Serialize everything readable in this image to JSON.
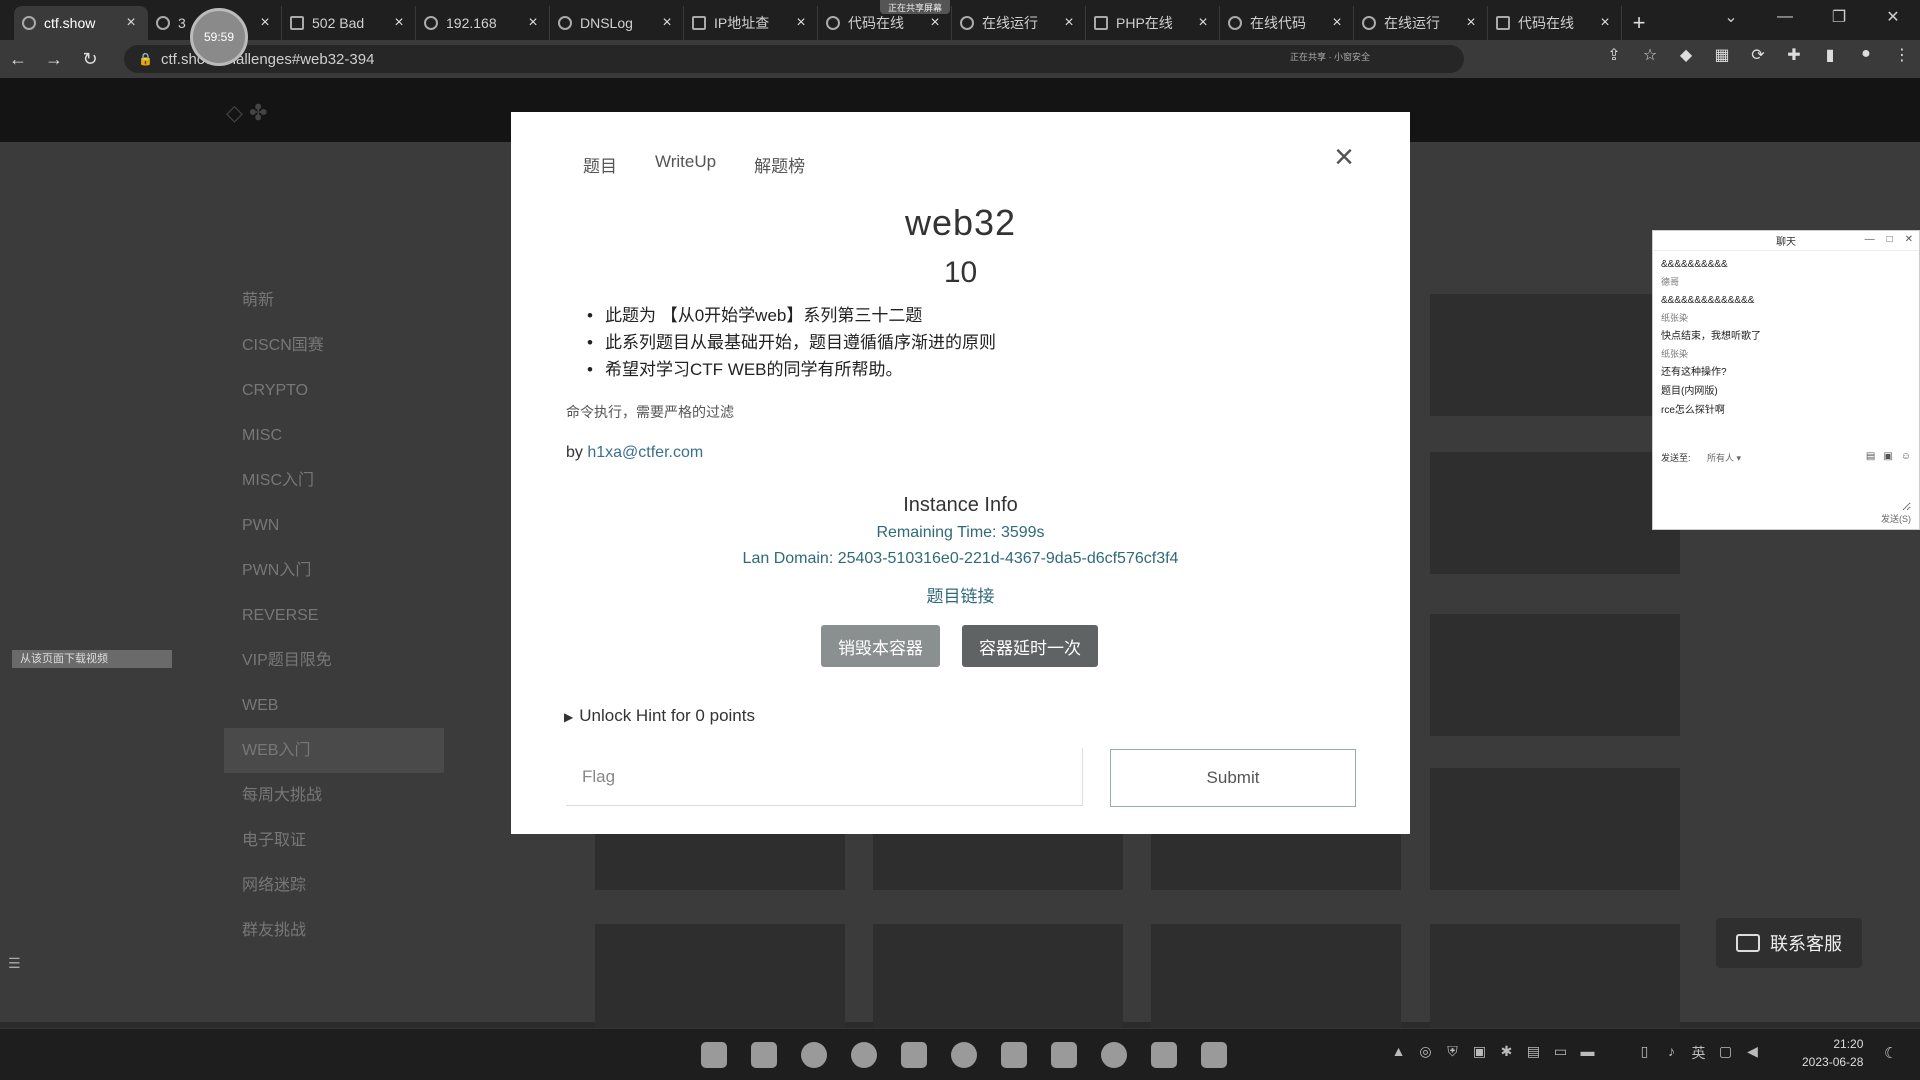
{
  "browser": {
    "tabs": [
      {
        "title": "ctf.show",
        "active": true
      },
      {
        "title": "3",
        "active": false
      },
      {
        "title": "502 Bad",
        "active": false
      },
      {
        "title": "192.168",
        "active": false
      },
      {
        "title": "DNSLog",
        "active": false
      },
      {
        "title": "IP地址查",
        "active": false
      },
      {
        "title": "代码在线",
        "active": false
      },
      {
        "title": "在线运行",
        "active": false
      },
      {
        "title": "PHP在线",
        "active": false
      },
      {
        "title": "在线代码",
        "active": false
      },
      {
        "title": "在线运行",
        "active": false
      },
      {
        "title": "代码在线",
        "active": false
      }
    ],
    "new_tab": "+",
    "url": "ctf.show/challenges#web32-394",
    "share_indicator": "正在共享屏幕",
    "omnibox_status": "正在共享 · 小窗安全",
    "recording_badge": "59:59"
  },
  "sidebar": {
    "items": [
      {
        "label": "萌新",
        "active": false
      },
      {
        "label": "CISCN国赛",
        "active": false
      },
      {
        "label": "CRYPTO",
        "active": false
      },
      {
        "label": "MISC",
        "active": false
      },
      {
        "label": "MISC入门",
        "active": false
      },
      {
        "label": "PWN",
        "active": false
      },
      {
        "label": "PWN入门",
        "active": false
      },
      {
        "label": "REVERSE",
        "active": false
      },
      {
        "label": "VIP题目限免",
        "active": false
      },
      {
        "label": "WEB",
        "active": false
      },
      {
        "label": "WEB入门",
        "active": true
      },
      {
        "label": "每周大挑战",
        "active": false
      },
      {
        "label": "电子取证",
        "active": false
      },
      {
        "label": "网络迷踪",
        "active": false
      },
      {
        "label": "群友挑战",
        "active": false
      }
    ]
  },
  "side_strip": "从该页面下载视频",
  "modal": {
    "tabs": [
      "题目",
      "WriteUp",
      "解题榜"
    ],
    "close": "×",
    "title": "web32",
    "points": "10",
    "description": [
      "此题为 【从0开始学web】系列第三十二题",
      "此系列题目从最基础开始，题目遵循循序渐进的原则",
      "希望对学习CTF WEB的同学有所帮助。"
    ],
    "note": "命令执行，需要严格的过滤",
    "author_prefix": "by ",
    "author_email": "h1xa@ctfer.com",
    "instance": {
      "title": "Instance Info",
      "remaining": "Remaining Time: 3599s",
      "domain": "Lan Domain: 25403-510316e0-221d-4367-9da5-d6cf576cf3f4",
      "link_label": "题目链接"
    },
    "destroy_label": "销毁本容器",
    "extend_label": "容器延时一次",
    "hint_label": "Unlock Hint for 0 points",
    "flag_placeholder": "Flag",
    "submit_label": "Submit"
  },
  "chat": {
    "title": "聊天",
    "messages": [
      {
        "text": "&&&&&&&&&&",
        "nick": false
      },
      {
        "text": "德哥",
        "nick": true
      },
      {
        "text": "&&&&&&&&&&&&&&",
        "nick": false
      },
      {
        "text": "纸张染",
        "nick": true
      },
      {
        "text": "快点结束，我想听歌了",
        "nick": false
      },
      {
        "text": "纸张染",
        "nick": true
      },
      {
        "text": "还有这种操作?",
        "nick": false
      },
      {
        "text": "题目(内网版)",
        "nick": false
      },
      {
        "text": "rce怎么探针啊",
        "nick": false
      }
    ],
    "send_to_label": "发送至:",
    "send_to_value": "所有人 ▾",
    "send_button": "发送(S)"
  },
  "help_button": "联系客服",
  "taskbar": {
    "time": "21:20",
    "date": "2023-06-28",
    "ime": "英"
  }
}
